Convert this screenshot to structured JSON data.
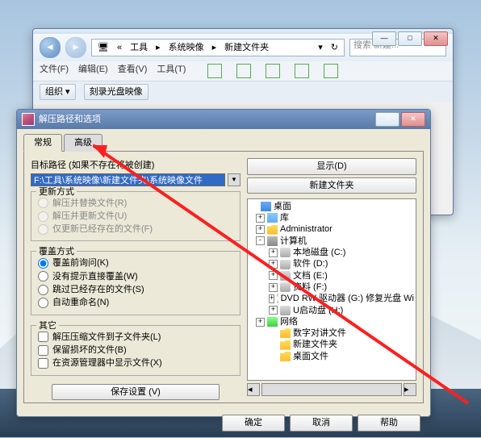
{
  "explorer": {
    "path": [
      "工具",
      "系统映像",
      "新建文件夹"
    ],
    "search_ph": "搜索 新建...",
    "menu": [
      "文件(F)",
      "编辑(E)",
      "查看(V)",
      "工具(T)"
    ],
    "toolbar": {
      "org": "组织 ▾",
      "burn": "刻录光盘映像"
    }
  },
  "dialog": {
    "title": "解压路径和选项",
    "tabs": {
      "general": "常规",
      "advanced": "高级"
    },
    "path_label": "目标路径 (如果不存在将被创建)",
    "path_value": "F:\\工具\\系统映像\\新建文件夹\\系统映像文件",
    "btn_show": "显示(D)",
    "btn_newf": "新建文件夹",
    "grp_update": {
      "title": "更新方式",
      "o1": "解压并替换文件(R)",
      "o2": "解压并更新文件(U)",
      "o3": "仅更新已经存在的文件(F)"
    },
    "grp_over": {
      "title": "覆盖方式",
      "o1": "覆盖前询问(K)",
      "o2": "没有提示直接覆盖(W)",
      "o3": "跳过已经存在的文件(S)",
      "o4": "自动重命名(N)"
    },
    "grp_misc": {
      "title": "其它",
      "o1": "解压压缩文件到子文件夹(L)",
      "o2": "保留损坏的文件(B)",
      "o3": "在资源管理器中显示文件(X)"
    },
    "save": "保存设置 (V)",
    "tree": [
      {
        "i": 0,
        "ex": "",
        "ic": "dsk",
        "t": "桌面"
      },
      {
        "i": 8,
        "ex": "+",
        "ic": "lib",
        "t": "库"
      },
      {
        "i": 8,
        "ex": "+",
        "ic": "fld",
        "t": "Administrator"
      },
      {
        "i": 8,
        "ex": "-",
        "ic": "cmp",
        "t": "计算机"
      },
      {
        "i": 24,
        "ex": "+",
        "ic": "drv",
        "t": "本地磁盘 (C:)"
      },
      {
        "i": 24,
        "ex": "+",
        "ic": "drv",
        "t": "软件 (D:)"
      },
      {
        "i": 24,
        "ex": "+",
        "ic": "drv",
        "t": "文档 (E:)"
      },
      {
        "i": 24,
        "ex": "+",
        "ic": "drv",
        "t": "资料 (F:)"
      },
      {
        "i": 24,
        "ex": "+",
        "ic": "dvd",
        "t": "DVD RW 驱动器 (G:) 修复光盘 Wi"
      },
      {
        "i": 24,
        "ex": "+",
        "ic": "drv",
        "t": "U启动盘 (H:)"
      },
      {
        "i": 8,
        "ex": "+",
        "ic": "net",
        "t": "网络"
      },
      {
        "i": 24,
        "ex": "",
        "ic": "fld",
        "t": "数字对讲文件"
      },
      {
        "i": 24,
        "ex": "",
        "ic": "fld",
        "t": "新建文件夹"
      },
      {
        "i": 24,
        "ex": "",
        "ic": "fld",
        "t": "桌面文件"
      }
    ],
    "ok": "确定",
    "cancel": "取消",
    "help": "帮助"
  }
}
